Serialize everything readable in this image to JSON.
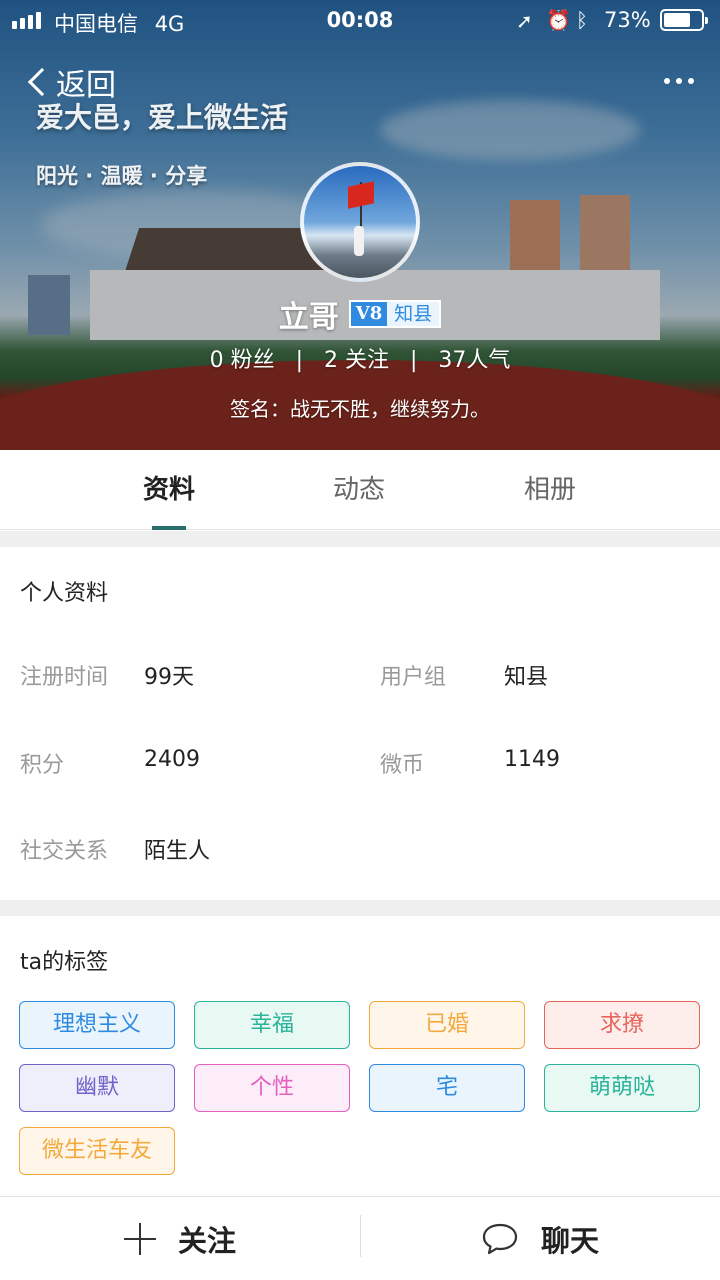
{
  "status_bar": {
    "carrier": "中国电信",
    "network": "4G",
    "time": "00:08",
    "battery_percent": "73%",
    "battery_level": 0.73
  },
  "nav": {
    "back_label": "返回"
  },
  "hero": {
    "slogan": "爱大邑，爱上微生活",
    "subtitle": "阳光 · 温暖 · 分享"
  },
  "profile": {
    "name": "立哥",
    "level": "V8",
    "title": "知县",
    "fans": "0 粉丝",
    "following": "2 关注",
    "popularity": "37人气",
    "signature": "签名：战无不胜，继续努力。"
  },
  "tabs": [
    {
      "label": "资料"
    },
    {
      "label": "动态"
    },
    {
      "label": "相册"
    }
  ],
  "info": {
    "title": "个人资料",
    "fields": [
      {
        "label": "注册时间",
        "value": "99天"
      },
      {
        "label": "用户组",
        "value": "知县"
      },
      {
        "label": "积分",
        "value": "2409"
      },
      {
        "label": "微币",
        "value": "1149"
      },
      {
        "label": "社交关系",
        "value": "陌生人"
      }
    ]
  },
  "tags_section": {
    "title": "ta的标签",
    "tags": [
      {
        "label": "理想主义",
        "color": "#2f8be0",
        "bg": "#eaf4fd"
      },
      {
        "label": "幸福",
        "color": "#2bb39a",
        "bg": "#e8f8f3"
      },
      {
        "label": "已婚",
        "color": "#f3a93e",
        "bg": "#fff6e9"
      },
      {
        "label": "求撩",
        "color": "#e7645a",
        "bg": "#fdeeec"
      },
      {
        "label": "幽默",
        "color": "#6f62c9",
        "bg": "#efeefb"
      },
      {
        "label": "个性",
        "color": "#e35fc0",
        "bg": "#fcedf8"
      },
      {
        "label": "宅",
        "color": "#2f8be0",
        "bg": "#eaf4fd"
      },
      {
        "label": "萌萌哒",
        "color": "#2bb39a",
        "bg": "#e8f8f3"
      },
      {
        "label": "微生活车友",
        "color": "#f3a93e",
        "bg": "#fff6e9"
      }
    ]
  },
  "actions": {
    "follow_label": "关注",
    "chat_label": "聊天"
  }
}
